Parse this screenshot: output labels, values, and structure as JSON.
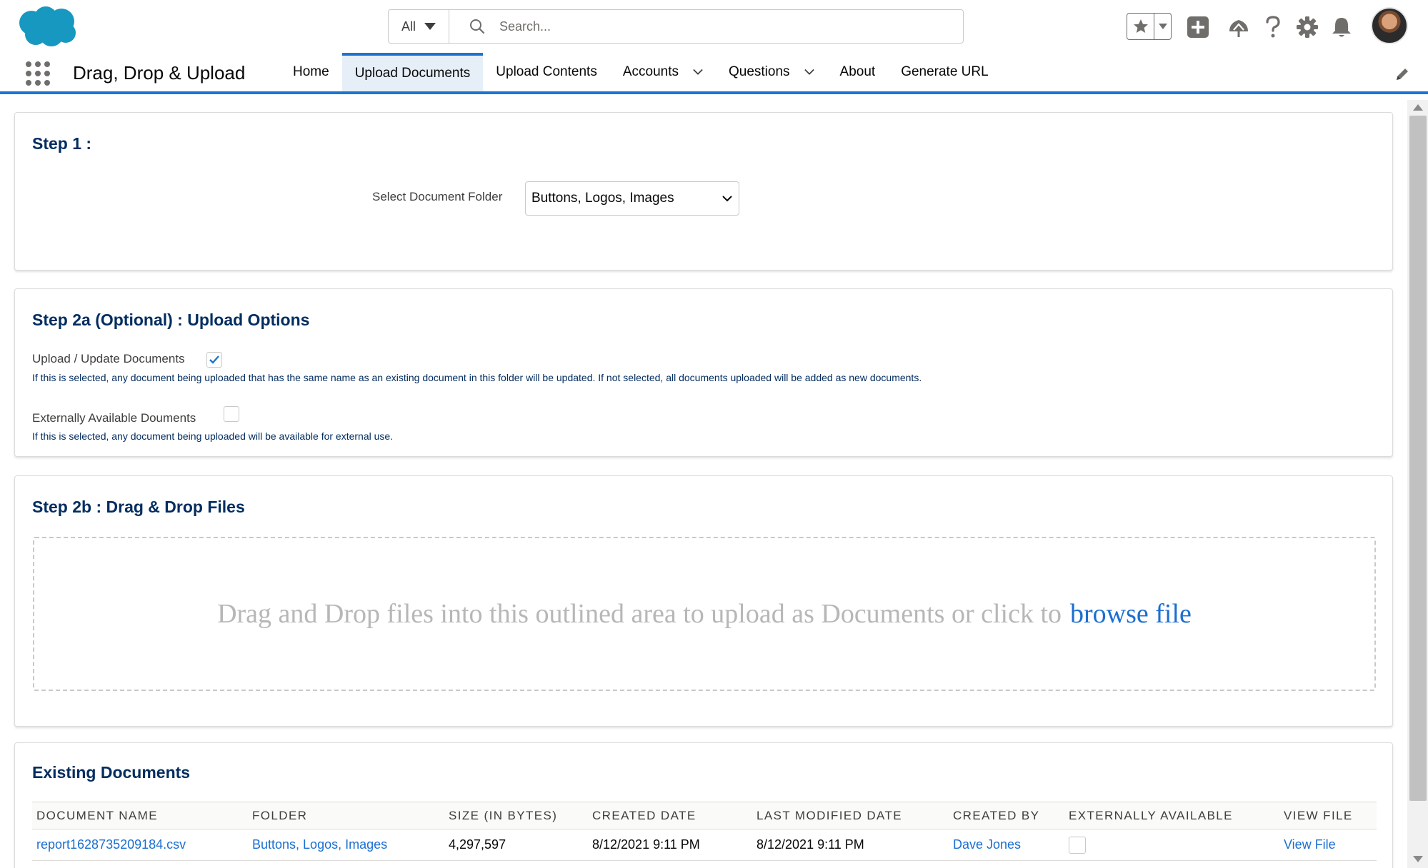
{
  "header": {
    "search_scope": "All",
    "search_placeholder": "Search..."
  },
  "nav": {
    "app_name": "Drag, Drop & Upload",
    "items": [
      {
        "label": "Home"
      },
      {
        "label": "Upload Documents"
      },
      {
        "label": "Upload Contents"
      },
      {
        "label": "Accounts"
      },
      {
        "label": "Questions"
      },
      {
        "label": "About"
      },
      {
        "label": "Generate URL"
      }
    ],
    "active_item": "Upload Documents"
  },
  "step1": {
    "title": "Step 1 :",
    "folder_label": "Select Document Folder",
    "folder_value": "Buttons, Logos, Images"
  },
  "step2a": {
    "title": "Step 2a (Optional) : Upload Options",
    "upload_update_label": "Upload / Update Documents",
    "upload_update_checked": true,
    "upload_update_help": "If this is selected, any document being uploaded that has the same name as an existing document in this folder will be updated. If not selected, all documents uploaded will be added as new documents.",
    "external_label": "Externally Available Douments",
    "external_checked": false,
    "external_help": "If this is selected, any document being uploaded will be available for external use."
  },
  "step2b": {
    "title": "Step 2b : Drag & Drop Files",
    "drop_text": "Drag and Drop files into this outlined area to upload as Documents or click to",
    "browse_link": "browse file"
  },
  "existing": {
    "title": "Existing Documents",
    "columns": [
      "DOCUMENT NAME",
      "FOLDER",
      "SIZE (IN BYTES)",
      "CREATED DATE",
      "LAST MODIFIED DATE",
      "CREATED BY",
      "EXTERNALLY AVAILABLE",
      "VIEW FILE"
    ],
    "rows": [
      {
        "name": "report1628735209184.csv",
        "folder": "Buttons, Logos, Images",
        "size": "4,297,597",
        "created_date": "8/12/2021 9:11 PM",
        "modified_date": "8/12/2021 9:11 PM",
        "created_by": "Dave Jones",
        "external": false,
        "view": "View File"
      }
    ]
  },
  "colors": {
    "brand_blue": "#1b75d0",
    "heading_navy": "#032d60",
    "link_blue": "#1b6fd1",
    "cloud_blue": "#1798c1"
  }
}
